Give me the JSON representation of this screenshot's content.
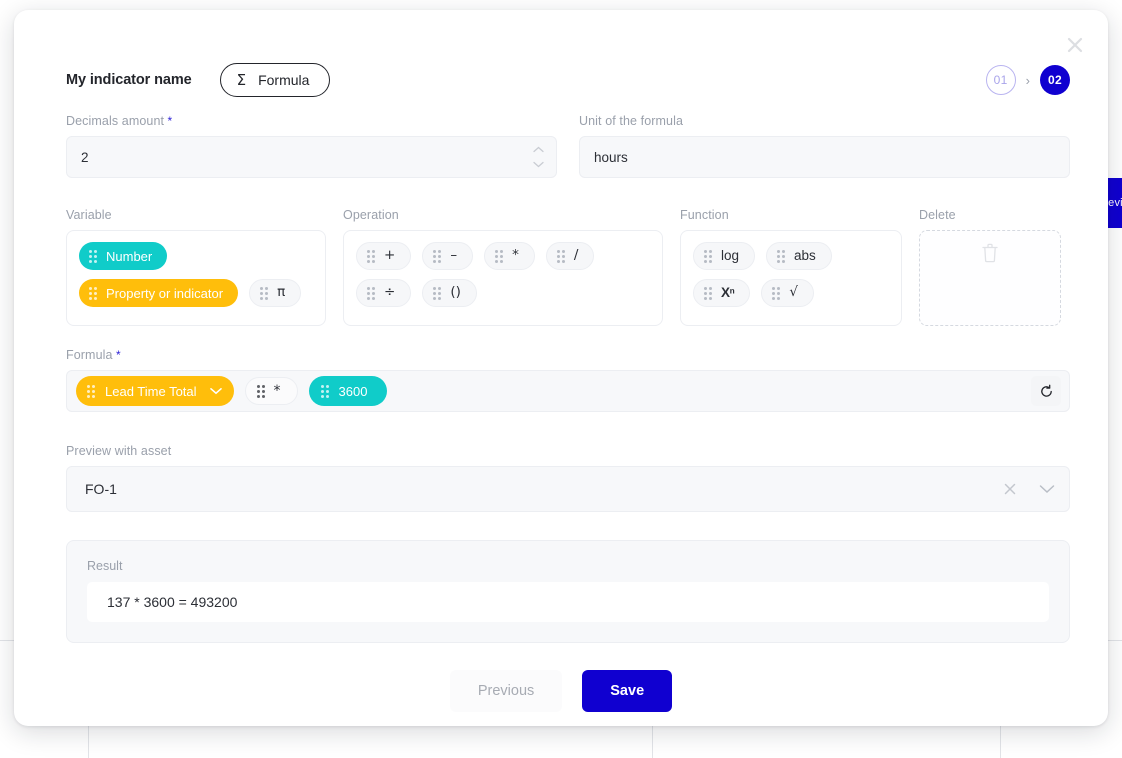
{
  "background": {
    "feedback_tab_label": "Review",
    "column_positions": [
      88,
      652,
      1218
    ]
  },
  "modal": {
    "close_icon": "close-icon",
    "header": {
      "indicator_title": "My indicator name",
      "formula_button_label": "Formula",
      "formula_button_icon": "sigma-icon",
      "stepper": {
        "step_one": "01",
        "step_two": "02",
        "separator": "›",
        "active_step": "02",
        "active_color": "#1000d0",
        "inactive_border_color": "#b9b4f0"
      }
    },
    "fields": {
      "decimals": {
        "label": "Decimals amount",
        "required": true,
        "value": "2",
        "spinner_up_icon": "chevron-up-icon",
        "spinner_down_icon": "chevron-down-icon"
      },
      "unit": {
        "label": "Unit of the formula",
        "required": false,
        "value": "hours"
      }
    },
    "palettes": [
      {
        "key": "variable",
        "label": "Variable",
        "chips": [
          {
            "label": "Number",
            "style": "teal",
            "icon": "drag-handle-icon"
          },
          {
            "label": "Property or indicator",
            "style": "amber",
            "icon": "drag-handle-icon"
          },
          {
            "label": "π",
            "style": "plain",
            "icon": "drag-handle-icon"
          }
        ]
      },
      {
        "key": "operation",
        "label": "Operation",
        "chips": [
          {
            "label": "+",
            "style": "plain",
            "icon": "drag-handle-icon"
          },
          {
            "label": "–",
            "style": "plain",
            "icon": "drag-handle-icon"
          },
          {
            "label": "*",
            "style": "plain",
            "icon": "drag-handle-icon"
          },
          {
            "label": "/",
            "style": "plain",
            "icon": "drag-handle-icon"
          },
          {
            "label": "÷",
            "style": "plain",
            "icon": "drag-handle-icon"
          },
          {
            "label": "()",
            "style": "plain",
            "icon": "drag-handle-icon"
          }
        ]
      },
      {
        "key": "function",
        "label": "Function",
        "chips": [
          {
            "label": "log",
            "style": "plain",
            "icon": "drag-handle-icon"
          },
          {
            "label": "abs",
            "style": "plain",
            "icon": "drag-handle-icon"
          },
          {
            "label": "Xⁿ",
            "style": "plain",
            "icon": "drag-handle-icon"
          },
          {
            "label": "√",
            "style": "plain",
            "icon": "drag-handle-icon"
          }
        ]
      }
    ],
    "delete_zone": {
      "label": "Delete",
      "icon": "trash-icon"
    },
    "formula": {
      "label": "Formula",
      "required": true,
      "tokens": [
        {
          "label": "Lead Time Total",
          "style": "amber",
          "has_dropdown": true
        },
        {
          "label": "*",
          "style": "plain",
          "has_dropdown": false
        },
        {
          "label": "3600",
          "style": "teal",
          "has_dropdown": false
        }
      ],
      "reset_icon": "reset-icon"
    },
    "preview": {
      "label": "Preview with asset",
      "value": "FO-1",
      "clear_icon": "close-icon",
      "dropdown_icon": "chevron-down-icon"
    },
    "result": {
      "label": "Result",
      "value": "137 * 3600 = 493200"
    },
    "footer": {
      "previous_label": "Previous",
      "save_label": "Save"
    }
  },
  "colors": {
    "accent_blue": "#1000d0",
    "teal": "#10ccc9",
    "amber": "#ffbe0b",
    "muted_text": "#9aa0ab"
  }
}
